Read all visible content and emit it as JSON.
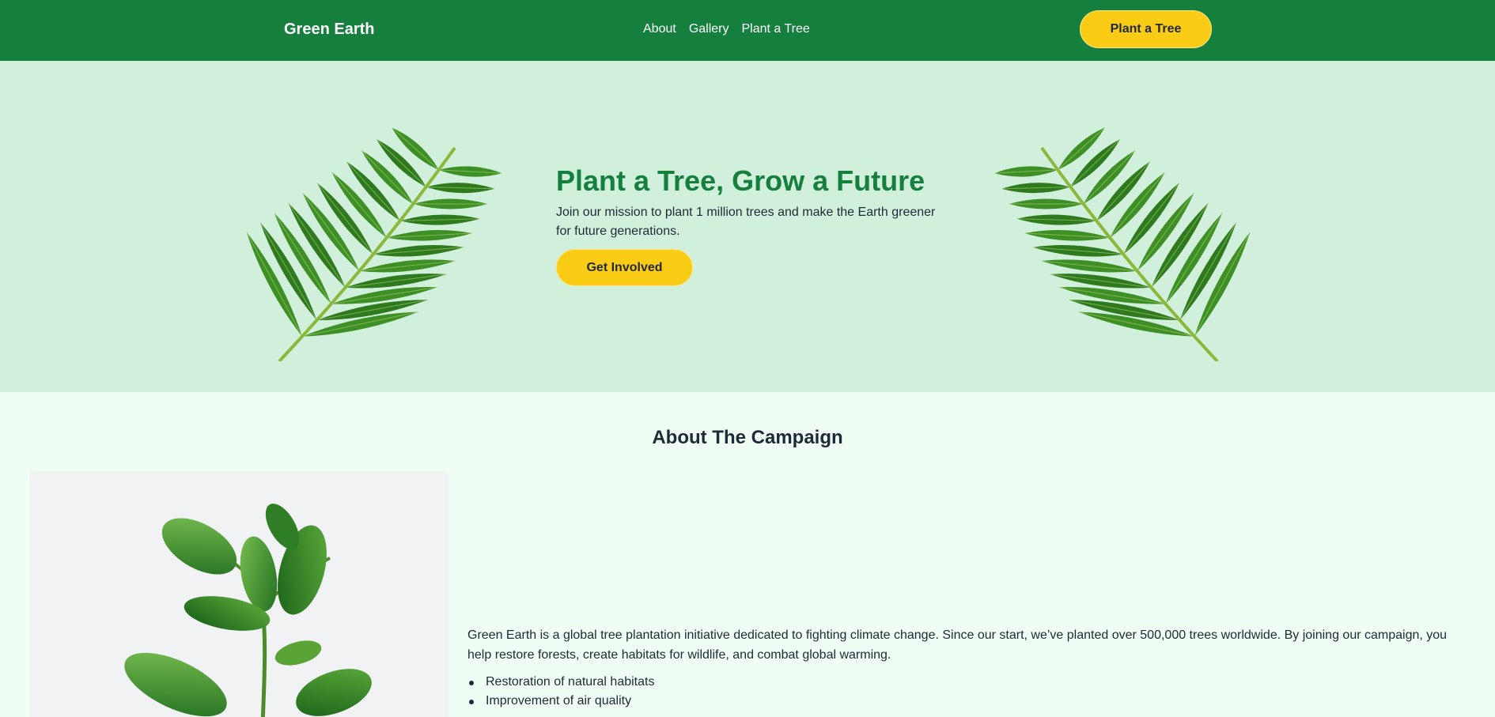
{
  "header": {
    "brand": "Green Earth",
    "nav": [
      "About",
      "Gallery",
      "Plant a Tree"
    ],
    "cta": "Plant a Tree"
  },
  "hero": {
    "title": "Plant a Tree, Grow a Future",
    "subtitle": "Join our mission to plant 1 million trees and make the Earth greener for future generations.",
    "button": "Get Involved"
  },
  "about": {
    "title": "About The Campaign",
    "description": "Green Earth is a global tree plantation initiative dedicated to fighting climate change. Since our start, we’ve planted over 500,000 trees worldwide. By joining our campaign, you help restore forests, create habitats for wildlife, and combat global warming.",
    "points": [
      "Restoration of natural habitats",
      "Improvement of air quality"
    ]
  },
  "colors": {
    "primary": "#15803d",
    "accent": "#facc15",
    "hero_bg": "#d0f0dc",
    "page_bg": "#f0fdf4"
  },
  "icons": {
    "hero_left": "palm-leaf-icon",
    "hero_right": "palm-leaf-icon",
    "about": "potted-plant-image"
  }
}
